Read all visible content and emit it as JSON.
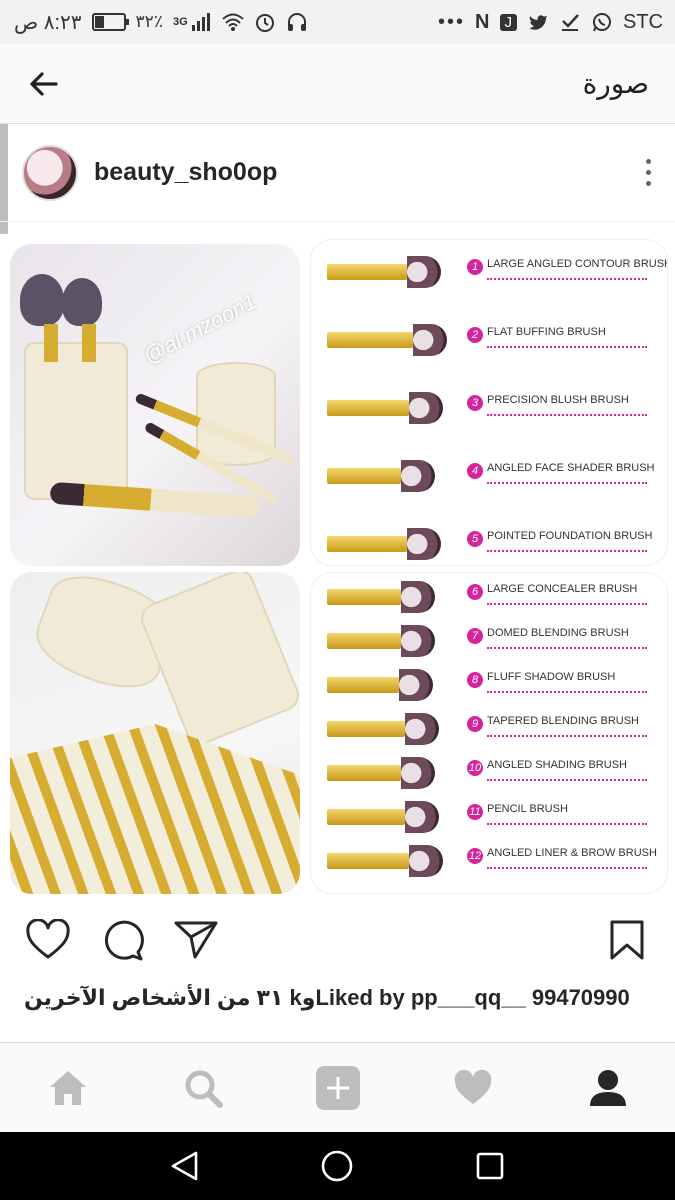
{
  "status_bar": {
    "time": "٨:٢٣ ص",
    "battery": "٣٢٪",
    "battery_level": 0.32,
    "network": "3G",
    "carrier": "STC",
    "notif_n": "N",
    "notif_j": "J"
  },
  "app_bar": {
    "title": "صورة",
    "back_icon": "arrow-left-icon"
  },
  "post": {
    "username": "beauty_sho0op",
    "menu_icon": "more-vertical-icon",
    "image_watermark": "@al.mzoon1",
    "brushes_top": [
      {
        "num": "1",
        "label": "LARGE ANGLED CONTOUR BRUSH"
      },
      {
        "num": "2",
        "label": "FLAT BUFFING BRUSH"
      },
      {
        "num": "3",
        "label": "PRECISION BLUSH BRUSH"
      },
      {
        "num": "4",
        "label": "ANGLED FACE SHADER BRUSH"
      },
      {
        "num": "5",
        "label": "POINTED FOUNDATION BRUSH"
      }
    ],
    "brushes_bottom": [
      {
        "num": "6",
        "label": "LARGE CONCEALER BRUSH"
      },
      {
        "num": "7",
        "label": "DOMED BLENDING BRUSH"
      },
      {
        "num": "8",
        "label": "FLUFF SHADOW BRUSH"
      },
      {
        "num": "9",
        "label": "TAPERED BLENDING BRUSH"
      },
      {
        "num": "10",
        "label": "ANGLED SHADING BRUSH"
      },
      {
        "num": "11",
        "label": "PENCIL BRUSH"
      },
      {
        "num": "12",
        "label": "ANGLED LINER & BROW BRUSH"
      }
    ],
    "likes_text": "Liked by pp___qq__ 99470990وk ٣١ من الأشخاص الآخرين"
  },
  "actions": {
    "like_icon": "heart-icon",
    "comment_icon": "comment-icon",
    "share_icon": "send-icon",
    "save_icon": "bookmark-icon"
  },
  "bottom_nav": [
    "home-icon",
    "search-icon",
    "add-icon",
    "activity-heart-icon",
    "profile-icon"
  ],
  "system_nav": [
    "back-triangle-icon",
    "home-circle-icon",
    "recents-square-icon"
  ],
  "colors": {
    "accent": "#d6249f",
    "text": "#262626"
  }
}
